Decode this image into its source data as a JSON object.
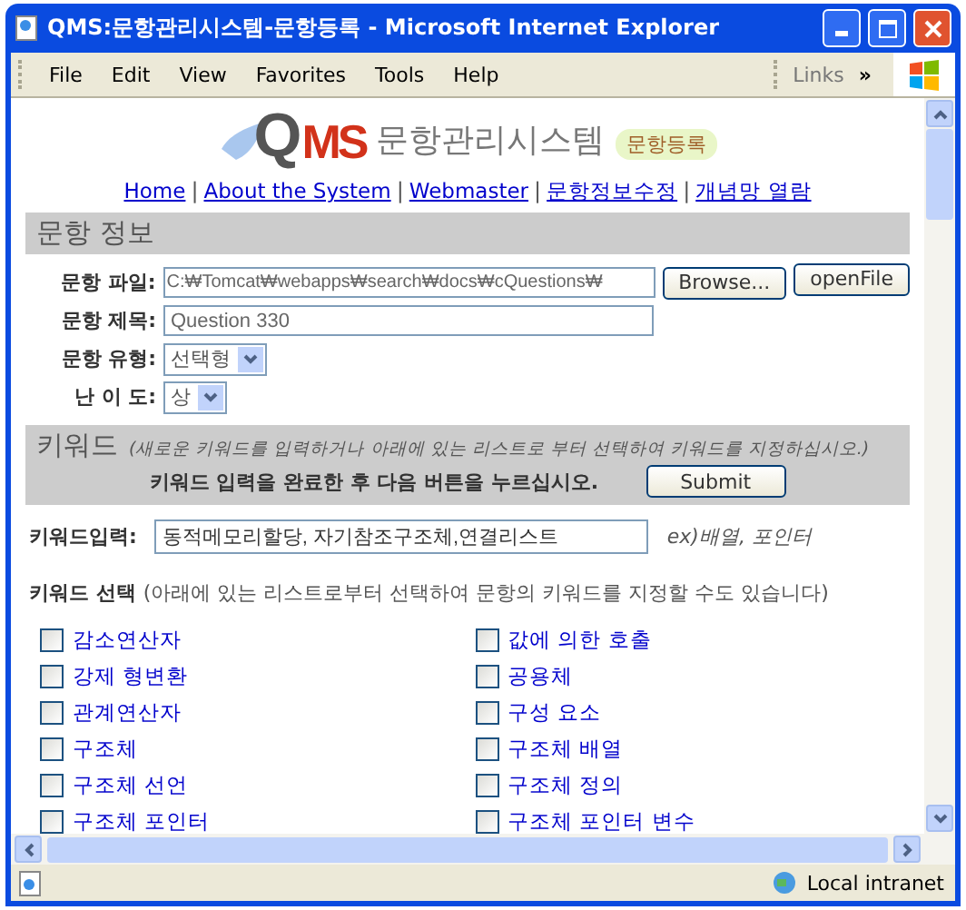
{
  "window": {
    "title": "QMS:문항관리시스템-문항등록 - Microsoft Internet Explorer"
  },
  "menu": [
    "File",
    "Edit",
    "View",
    "Favorites",
    "Tools",
    "Help"
  ],
  "links": {
    "label": "Links",
    "more": "»"
  },
  "logo": {
    "mark_q": "Q",
    "mark_ms": "MS",
    "name": "문항관리시스템",
    "badge": "문항등록"
  },
  "nav": [
    "Home",
    "About the System",
    "Webmaster",
    "문항정보수정",
    "개념망 열람"
  ],
  "nav_separator": "|",
  "item_info": {
    "heading": "문항 정보",
    "fields": [
      {
        "kind": "file",
        "label": "문항 파일:",
        "value": "C:₩Tomcat₩webapps₩search₩docs₩cQuestions₩",
        "browse": "Browse...",
        "open": "openFile"
      },
      {
        "kind": "text",
        "label": "문항 제목:",
        "value": "Question 330"
      },
      {
        "kind": "select",
        "label": "문항 유형:",
        "value": "선택형"
      },
      {
        "kind": "select",
        "label": "난 이 도:",
        "value": "상"
      }
    ]
  },
  "keyword": {
    "heading": "키워드",
    "note": "(새로운 키워드를 입력하거나 아래에 있는 리스트로 부터 선택하여 키워드를 지정하십시오.)",
    "instruction": "키워드 입력을 완료한 후 다음 버튼을 누르십시오.",
    "submit": "Submit",
    "input_label": "키워드입력:",
    "input_value": "동적메모리할당, 자기참조구조체,연결리스트",
    "example": "ex)배열, 포인터",
    "select_heading": "키워드 선택",
    "select_note": "(아래에 있는 리스트로부터 선택하여 문항의 키워드를 지정할 수도 있습니다)",
    "options": [
      {
        "label": "감소연산자",
        "checked": false
      },
      {
        "label": "값에 의한 호출",
        "checked": false
      },
      {
        "label": "강제 형변환",
        "checked": false
      },
      {
        "label": "공용체",
        "checked": false
      },
      {
        "label": "관계연산자",
        "checked": false
      },
      {
        "label": "구성 요소",
        "checked": false
      },
      {
        "label": "구조체",
        "checked": false
      },
      {
        "label": "구조체 배열",
        "checked": false
      },
      {
        "label": "구조체 선언",
        "checked": false
      },
      {
        "label": "구조체 정의",
        "checked": false
      },
      {
        "label": "구조체 포인터",
        "checked": false
      },
      {
        "label": "구조체 포인터 변수",
        "checked": false
      }
    ]
  },
  "status_bar": {
    "zone": "Local intranet"
  }
}
